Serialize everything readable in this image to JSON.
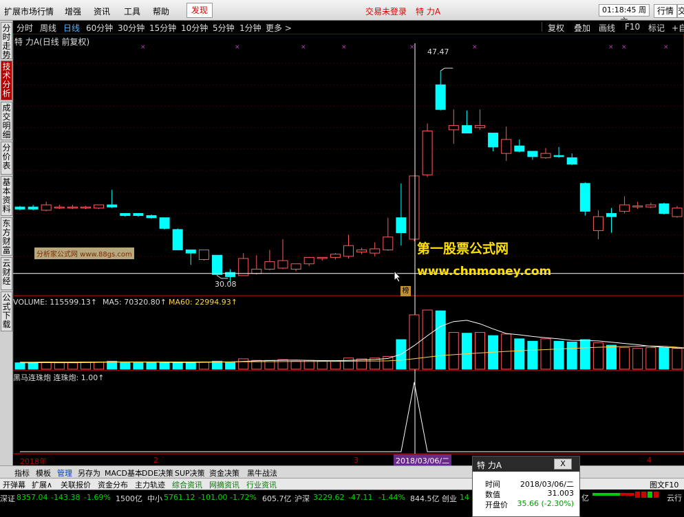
{
  "menubar": {
    "items": [
      "扩展市场行情",
      "增强",
      "资讯",
      "工具",
      "帮助"
    ],
    "hot_item": "发现",
    "status": "交易未登录",
    "stock_name": "特 力A",
    "time": "01:18:45 周六",
    "right_tabs": [
      "行情",
      "交"
    ]
  },
  "periodbar": {
    "items": [
      "分时",
      "周线",
      "日线",
      "60分钟",
      "30分钟",
      "15分钟",
      "10分钟",
      "5分钟",
      "1分钟",
      "更多 >"
    ],
    "active": "日线",
    "right_items": [
      "复权",
      "叠加",
      "画线",
      "F10",
      "标记",
      "+自"
    ]
  },
  "left_tabs": [
    "分时走势",
    "技术分析",
    "成交明细",
    "分价表",
    "基本资料",
    "东方财富",
    "云财经",
    "公式下载"
  ],
  "active_left_tab": "技术分析",
  "chart_title": "特 力A(日线 前复权)",
  "price_high_label": "47.47",
  "price_low_label": "30.08",
  "watermark_small": "分析家公式网 www.88gs.com",
  "watermark_big_1": "第一股票公式网",
  "watermark_big_2": "www.chnmoney.com",
  "tag_label": "榜",
  "volume_header": {
    "vol": "VOLUME: 115599.13↑",
    "ma5": "MA5: 70320.80↑",
    "ma60": "MA60: 22994.93↑"
  },
  "indicator_header": "黑马连珠炮  连珠炮: 1.00↑",
  "date_axis": {
    "labels": [
      "2018年",
      "2",
      "3",
      "4"
    ],
    "cursor_date": "2018/03/06/二"
  },
  "tool_tabs": [
    "指标",
    "模板",
    "管理",
    "另存为",
    "MACD基本",
    "DDE决策",
    "SUP决策",
    "资金决策",
    "黑牛战法"
  ],
  "active_tool_tab": "管理",
  "func_bar": [
    "开弹幕",
    "扩展∧",
    "关联报价",
    "资金分布",
    "主力轨迹",
    "综合资讯",
    "网摘资讯",
    "行业资讯"
  ],
  "func_bar_right": "图文F10",
  "ticker": [
    {
      "text": "深证",
      "color": "#dddddd"
    },
    {
      "text": "8357.04",
      "color": "#00dd00"
    },
    {
      "text": "-143.38",
      "color": "#00dd00"
    },
    {
      "text": "-1.69%",
      "color": "#00dd00"
    },
    {
      "text": "1500亿",
      "color": "#dddddd"
    },
    {
      "text": "中小",
      "color": "#dddddd"
    },
    {
      "text": "5761.12",
      "color": "#00dd00"
    },
    {
      "text": "-101.00",
      "color": "#00dd00"
    },
    {
      "text": "-1.72%",
      "color": "#00dd00"
    },
    {
      "text": "605.7亿",
      "color": "#dddddd"
    },
    {
      "text": "沪深",
      "color": "#dddddd"
    },
    {
      "text": "3229.62",
      "color": "#00dd00"
    },
    {
      "text": "-47.11",
      "color": "#00dd00"
    },
    {
      "text": "-1.44%",
      "color": "#00dd00"
    },
    {
      "text": "844.5亿",
      "color": "#dddddd"
    },
    {
      "text": "创业",
      "color": "#dddddd"
    },
    {
      "text": "14",
      "color": "#00dd00"
    }
  ],
  "ticker_right": {
    "unit": "亿",
    "label": "云行"
  },
  "popup": {
    "title": "特 力A",
    "close": "X",
    "rows": [
      {
        "key": "时间",
        "value": "2018/03/06/二"
      },
      {
        "key": "数值",
        "value": "31.003"
      },
      {
        "key": "开盘价",
        "value": "35.66 (-2.30%)"
      }
    ]
  },
  "colors": {
    "up": "#ff5a5a",
    "down": "#00ffff",
    "ma5": "#ffffff",
    "ma60": "#ffd24a",
    "cursor_bg": "#6a2a8a"
  },
  "chart_data": {
    "type": "candlestick",
    "title": "特 力A(日线 前复权)",
    "ylim": [
      28,
      50
    ],
    "series": [
      {
        "o": 34.6,
        "c": 34.4,
        "h": 34.7,
        "l": 34.3
      },
      {
        "o": 34.6,
        "c": 34.4,
        "h": 34.8,
        "l": 34.3
      },
      {
        "o": 34.3,
        "c": 34.8,
        "h": 35.1,
        "l": 34.2
      },
      {
        "o": 34.6,
        "c": 34.6,
        "h": 34.8,
        "l": 34.4
      },
      {
        "o": 34.6,
        "c": 34.6,
        "h": 34.8,
        "l": 34.4
      },
      {
        "o": 34.6,
        "c": 34.6,
        "h": 34.7,
        "l": 34.4
      },
      {
        "o": 34.5,
        "c": 34.8,
        "h": 34.8,
        "l": 34.4
      },
      {
        "o": 34.8,
        "c": 34.6,
        "h": 36.2,
        "l": 34.5
      },
      {
        "o": 34.0,
        "c": 33.8,
        "h": 34.0,
        "l": 33.7
      },
      {
        "o": 34.0,
        "c": 33.8,
        "h": 34.0,
        "l": 33.7
      },
      {
        "o": 33.8,
        "c": 33.6,
        "h": 33.9,
        "l": 33.5
      },
      {
        "o": 33.6,
        "c": 32.6,
        "h": 33.6,
        "l": 32.5
      },
      {
        "o": 32.5,
        "c": 30.6,
        "h": 32.6,
        "l": 30.6
      },
      {
        "o": 30.6,
        "c": 30.3,
        "h": 30.6,
        "l": 29.2
      },
      {
        "o": 29.7,
        "c": 30.6,
        "h": 30.6,
        "l": 29.6
      },
      {
        "o": 30.1,
        "c": 28.3,
        "h": 30.1,
        "l": 28.2
      },
      {
        "o": 28.5,
        "c": 28.1,
        "h": 28.8,
        "l": 27.6
      },
      {
        "o": 28.2,
        "c": 29.8,
        "h": 30.3,
        "l": 28.2
      },
      {
        "o": 28.4,
        "c": 28.8,
        "h": 30.1,
        "l": 28.3
      },
      {
        "o": 28.8,
        "c": 29.5,
        "h": 30.6,
        "l": 28.7
      },
      {
        "o": 28.9,
        "c": 29.6,
        "h": 31.6,
        "l": 28.8
      },
      {
        "o": 28.8,
        "c": 29.3,
        "h": 29.3,
        "l": 28.6
      },
      {
        "o": 29.3,
        "c": 29.9,
        "h": 29.9,
        "l": 29.1
      },
      {
        "o": 29.8,
        "c": 29.9,
        "h": 29.9,
        "l": 29.6
      },
      {
        "o": 29.9,
        "c": 30.2,
        "h": 30.3,
        "l": 29.7
      },
      {
        "o": 30.0,
        "c": 31.0,
        "h": 32.0,
        "l": 29.8
      },
      {
        "o": 30.4,
        "c": 30.6,
        "h": 30.8,
        "l": 30.2
      },
      {
        "o": 30.3,
        "c": 30.7,
        "h": 31.3,
        "l": 30.0
      },
      {
        "o": 30.6,
        "c": 31.8,
        "h": 33.6,
        "l": 30.5
      },
      {
        "o": 33.6,
        "c": 32.2,
        "h": 36.8,
        "l": 31.0
      },
      {
        "o": 31.6,
        "c": 37.5,
        "h": 37.5,
        "l": 31.4
      },
      {
        "o": 37.6,
        "c": 41.7,
        "h": 42.4,
        "l": 37.4
      },
      {
        "o": 46.0,
        "c": 43.7,
        "h": 47.3,
        "l": 43.6
      },
      {
        "o": 41.8,
        "c": 42.2,
        "h": 43.7,
        "l": 40.5
      },
      {
        "o": 42.2,
        "c": 41.5,
        "h": 43.6,
        "l": 41.5
      },
      {
        "o": 42.0,
        "c": 42.2,
        "h": 43.7,
        "l": 41.8
      },
      {
        "o": 41.5,
        "c": 40.2,
        "h": 41.5,
        "l": 39.8
      },
      {
        "o": 39.6,
        "c": 40.9,
        "h": 42.1,
        "l": 38.9
      },
      {
        "o": 40.3,
        "c": 39.8,
        "h": 40.9,
        "l": 39.7
      },
      {
        "o": 39.8,
        "c": 39.3,
        "h": 39.8,
        "l": 39.0
      },
      {
        "o": 39.2,
        "c": 39.6,
        "h": 40.1,
        "l": 39.1
      },
      {
        "o": 39.4,
        "c": 39.3,
        "h": 40.2,
        "l": 39.2
      },
      {
        "o": 39.2,
        "c": 38.6,
        "h": 39.6,
        "l": 38.5
      },
      {
        "o": 36.8,
        "c": 34.2,
        "h": 36.9,
        "l": 33.8
      },
      {
        "o": 32.4,
        "c": 33.7,
        "h": 34.3,
        "l": 31.6
      },
      {
        "o": 34.0,
        "c": 33.7,
        "h": 34.5,
        "l": 32.2
      },
      {
        "o": 34.2,
        "c": 34.8,
        "h": 35.6,
        "l": 34.0
      },
      {
        "o": 34.6,
        "c": 34.7,
        "h": 35.1,
        "l": 34.4
      },
      {
        "o": 34.6,
        "c": 34.8,
        "h": 35.0,
        "l": 34.5
      },
      {
        "o": 34.9,
        "c": 34.0,
        "h": 35.0,
        "l": 33.9
      },
      {
        "o": 33.7,
        "c": 34.5,
        "h": 34.7,
        "l": 33.6
      },
      {
        "o": 34.6,
        "c": 34.0,
        "h": 34.9,
        "l": 33.9
      }
    ],
    "volume": [
      8,
      8,
      9,
      8,
      8,
      9,
      9,
      10,
      8,
      8,
      9,
      8,
      9,
      8,
      9,
      10,
      9,
      13,
      11,
      11,
      12,
      10,
      11,
      10,
      10,
      14,
      13,
      14,
      16,
      37,
      68,
      74,
      73,
      46,
      45,
      46,
      42,
      44,
      38,
      35,
      38,
      35,
      34,
      37,
      33,
      30,
      27,
      26,
      27,
      27,
      26,
      25
    ],
    "indicator": [
      0,
      0,
      0,
      0,
      0,
      0,
      0,
      0,
      0,
      0,
      0,
      0,
      0,
      0,
      0,
      0,
      0,
      0,
      0,
      0,
      0,
      0,
      0,
      0,
      0,
      0,
      0,
      0,
      0,
      0,
      1,
      0,
      0,
      0,
      0,
      0,
      0,
      0,
      0,
      0,
      0,
      0,
      0,
      0,
      0,
      0,
      0,
      0,
      0,
      0,
      0,
      0
    ]
  }
}
